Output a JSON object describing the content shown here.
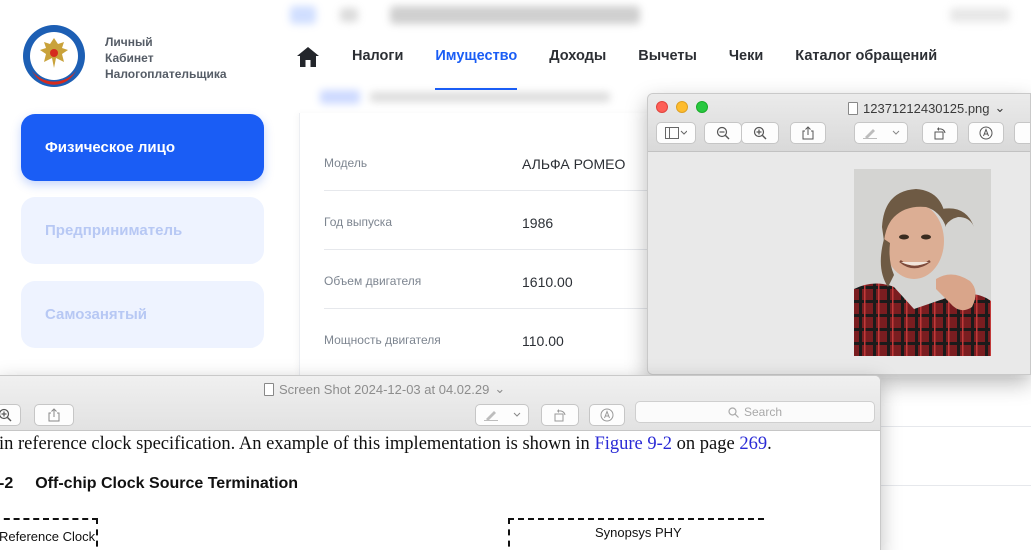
{
  "portal": {
    "logo_lines": [
      "Личный",
      "Кабинет",
      "Налогоплательщика"
    ],
    "nav": [
      {
        "label": "Налоги",
        "active": false
      },
      {
        "label": "Имущество",
        "active": true
      },
      {
        "label": "Доходы",
        "active": false
      },
      {
        "label": "Вычеты",
        "active": false
      },
      {
        "label": "Чеки",
        "active": false
      },
      {
        "label": "Каталог обращений",
        "active": false
      }
    ],
    "sidebar": [
      "Физическое лицо",
      "Предприниматель",
      "Самозанятый"
    ],
    "properties": [
      {
        "label": "Модель",
        "value": "АЛЬФА РОМЕО"
      },
      {
        "label": "Год выпуска",
        "value": "1986"
      },
      {
        "label": "Объем двигателя",
        "value": "1610.00"
      },
      {
        "label": "Мощность двигателя",
        "value": "110.00"
      }
    ],
    "accent_color": "#1a5df5"
  },
  "photo_window": {
    "title": "12371212430125.png",
    "chevron": "⌄"
  },
  "pdf_window": {
    "title": "Screen Shot 2024-12-03 at 04.02.29",
    "chevron": "⌄",
    "search_placeholder": "Search",
    "paragraph_text": "in reference clock specification. An example of this implementation is shown in ",
    "figure_link": "Figure 9-2",
    "paragraph_mid": " on page ",
    "page_link": "269",
    "paragraph_end": ".",
    "heading_num": "-2",
    "heading_text": "Off-chip Clock Source Termination",
    "diagram_label_left": "Reference Clock",
    "diagram_label_right": "Synopsys PHY"
  }
}
